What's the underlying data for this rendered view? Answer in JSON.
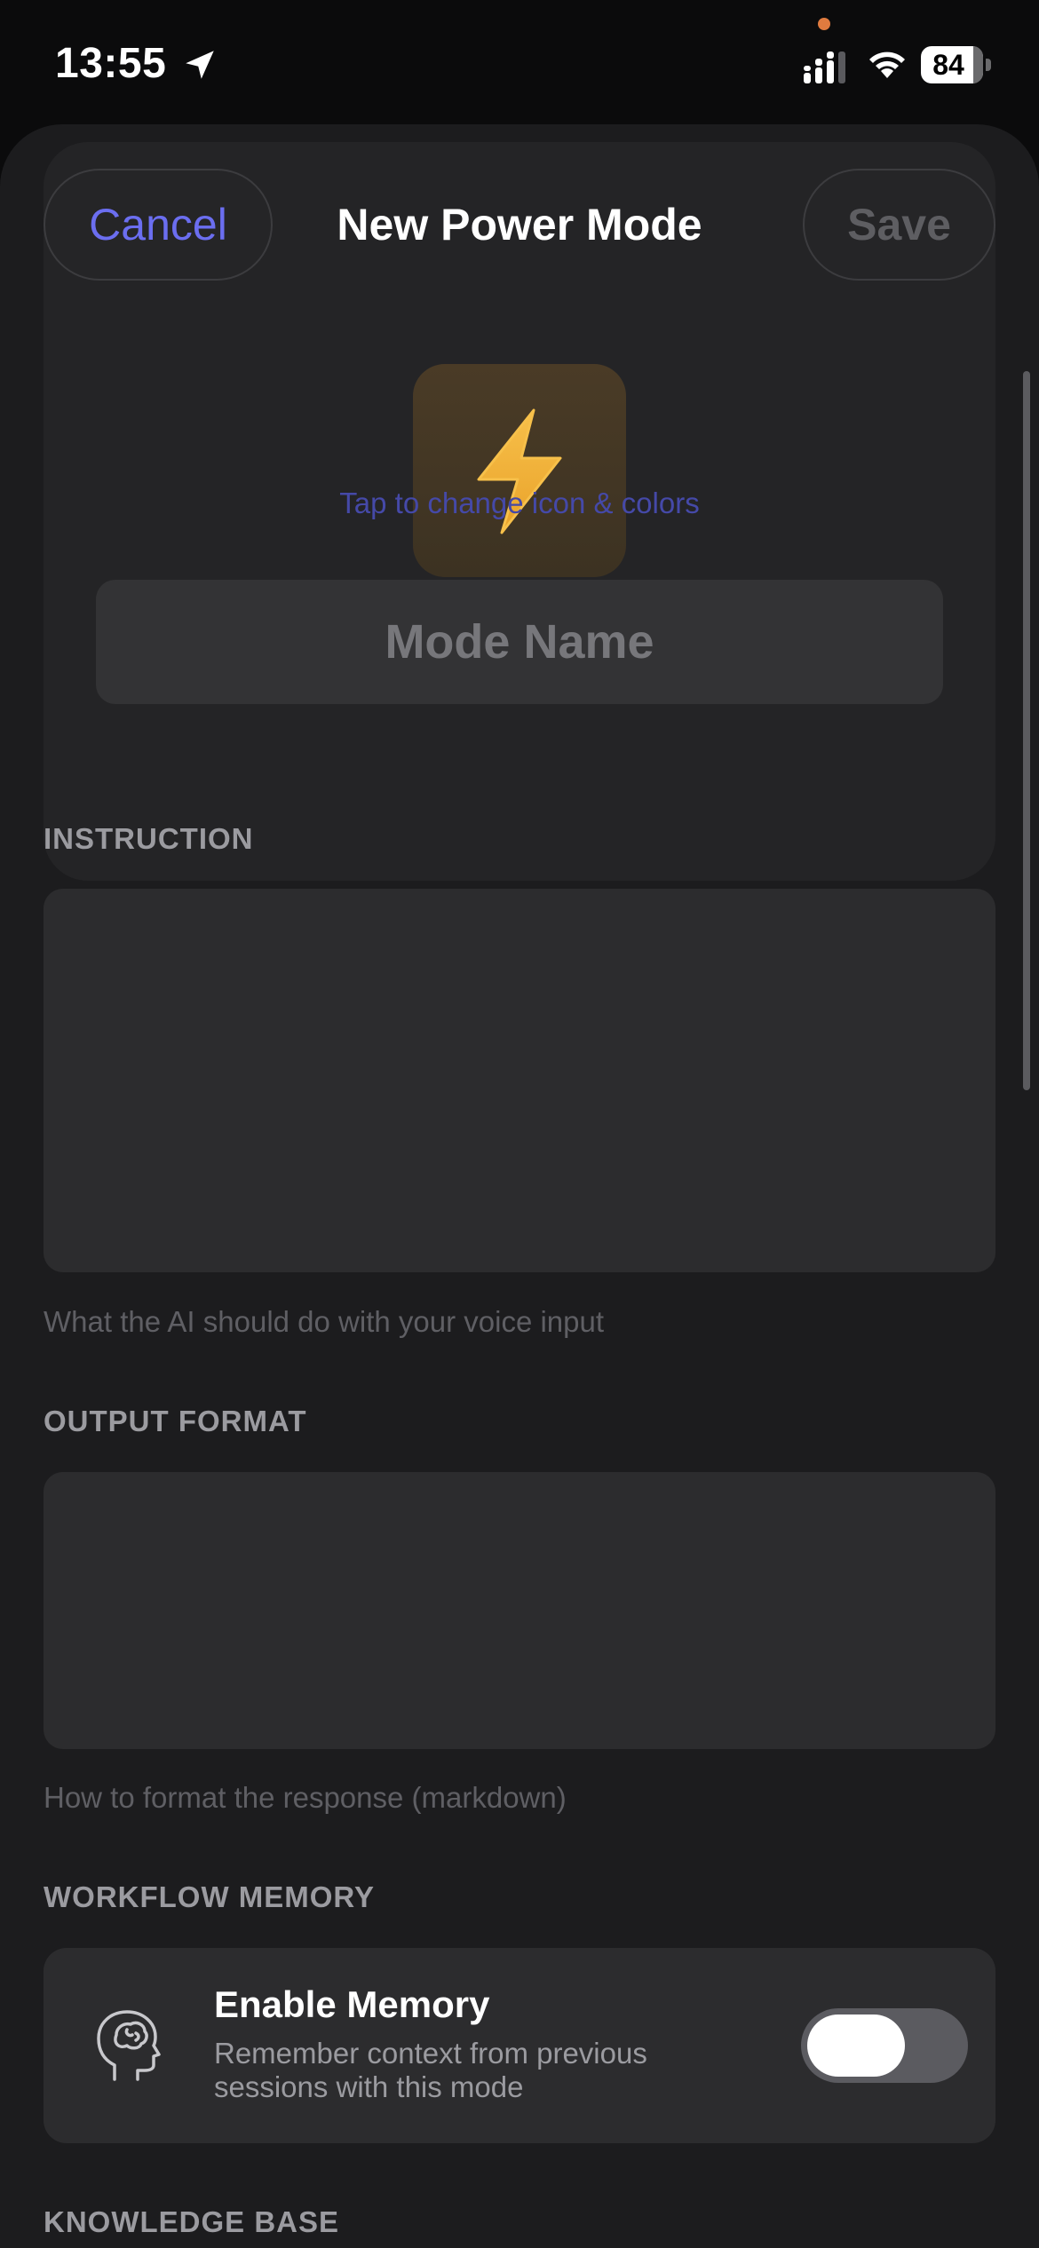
{
  "status_bar": {
    "time": "13:55",
    "battery_level": "84",
    "icons": [
      "location-arrow-icon",
      "signal-icon",
      "wifi-icon",
      "battery-icon"
    ]
  },
  "header": {
    "cancel_label": "Cancel",
    "title": "New Power Mode",
    "save_label": "Save"
  },
  "icon_picker": {
    "icon": "lightning-bolt-icon",
    "caption": "Tap to change icon & colors"
  },
  "mode_name": {
    "value": "",
    "placeholder": "Mode Name"
  },
  "instruction": {
    "label": "INSTRUCTION",
    "value": "",
    "helper": "What the AI should do with your voice input"
  },
  "output_format": {
    "label": "OUTPUT FORMAT",
    "value": "",
    "helper": "How to format the response (markdown)"
  },
  "workflow_memory": {
    "label": "WORKFLOW MEMORY",
    "icon": "brain-head-icon",
    "title": "Enable Memory",
    "description": "Remember context from previous sessions with this mode",
    "enabled": false
  },
  "knowledge_base": {
    "label": "KNOWLEDGE BASE"
  },
  "colors": {
    "accent": "#6b6ef0",
    "sheet_background": "#1c1c1e",
    "field_background": "#2c2c2e",
    "bolt": "#f2b134"
  }
}
